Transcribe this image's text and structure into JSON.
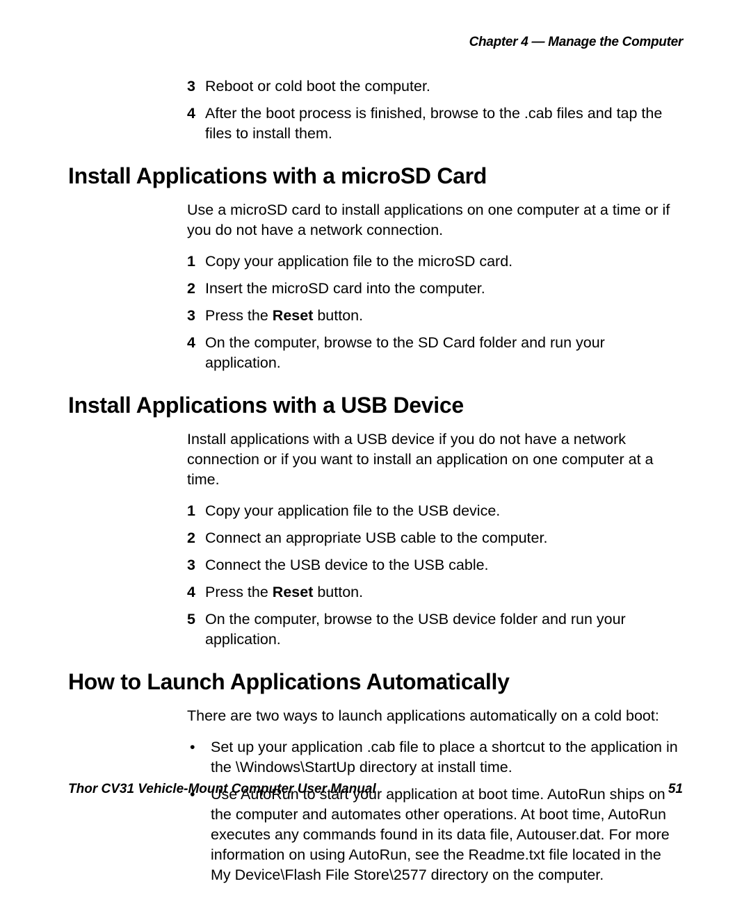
{
  "header": {
    "chapter": "Chapter 4 — Manage the Computer"
  },
  "intro_list": {
    "items": [
      {
        "num": "3",
        "text": "Reboot or cold boot the computer."
      },
      {
        "num": "4",
        "text": "After the boot process is finished, browse to the .cab files and tap the files to install them."
      }
    ]
  },
  "section_microsd": {
    "heading": "Install Applications with a microSD Card",
    "para": "Use a microSD card to install applications on one computer at a time or if you do not have a network connection.",
    "items": [
      {
        "num": "1",
        "text": "Copy your application file to the microSD card."
      },
      {
        "num": "2",
        "text": "Insert the microSD card into the computer."
      },
      {
        "num": "3",
        "pre": "Press the ",
        "bold": "Reset",
        "post": " button."
      },
      {
        "num": "4",
        "text": "On the computer, browse to the SD Card folder and run your application."
      }
    ]
  },
  "section_usb": {
    "heading": "Install Applications with a USB Device",
    "para": "Install applications with a USB device if you do not have a network connection or if you want to install an application on one computer at a time.",
    "items": [
      {
        "num": "1",
        "text": "Copy your application file to the USB device."
      },
      {
        "num": "2",
        "text": "Connect an appropriate USB cable to the computer."
      },
      {
        "num": "3",
        "text": "Connect the USB device to the USB cable."
      },
      {
        "num": "4",
        "pre": "Press the ",
        "bold": "Reset",
        "post": " button."
      },
      {
        "num": "5",
        "text": "On the computer, browse to the USB device folder and run your application."
      }
    ]
  },
  "section_launch": {
    "heading": "How to Launch Applications Automatically",
    "para": "There are two ways to launch applications automatically on a cold boot:",
    "bullets": [
      "Set up your application .cab file to place a shortcut to the application in the \\Windows\\StartUp directory at install time.",
      "Use AutoRun to start your application at boot time. AutoRun ships on the computer and automates other operations. At boot time, AutoRun executes any commands found in its data file, Autouser.dat. For more information on using AutoRun, see the Readme.txt file located in the My Device\\Flash File Store\\2577 directory on the computer."
    ]
  },
  "footer": {
    "title": "Thor CV31 Vehicle-Mount Computer User Manual",
    "page": "51"
  }
}
